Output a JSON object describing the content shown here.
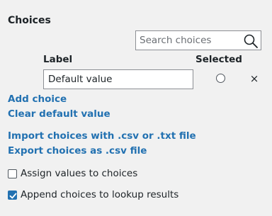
{
  "choices": {
    "title": "Choices",
    "search": {
      "placeholder": "Search choices",
      "value": "",
      "icon": "search-icon"
    },
    "columns": {
      "label": "Label",
      "selected": "Selected"
    },
    "items": [
      {
        "label_value": "Default value",
        "selected": false,
        "remove_glyph": "×"
      }
    ],
    "links": {
      "add_choice": "Add choice",
      "clear_default": "Clear default value",
      "import": "Import choices with .csv or .txt file",
      "export": "Export choices as .csv file"
    },
    "options": {
      "assign_values": {
        "label": "Assign values to choices",
        "checked": false
      },
      "append_lookup": {
        "label": "Append choices to lookup results",
        "checked": true
      }
    }
  },
  "colors": {
    "link": "#2271b1",
    "checkbox_checked": "#2271b1",
    "background": "#f1f1f1",
    "border": "#8c8f94",
    "text": "#1d2327"
  }
}
